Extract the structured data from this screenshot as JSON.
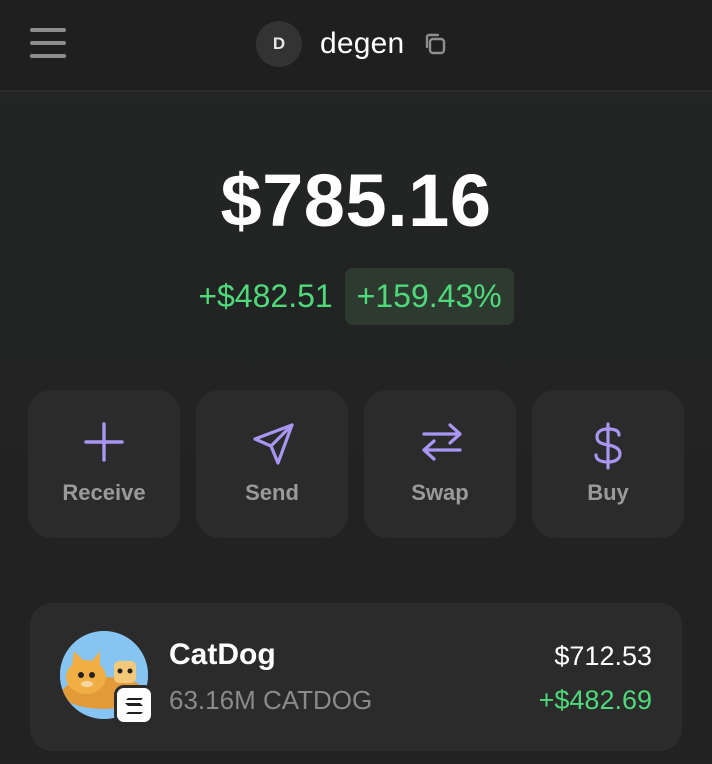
{
  "header": {
    "avatar_initial": "D",
    "account_name": "degen",
    "icons": [
      "menu-icon",
      "copy-icon"
    ]
  },
  "portfolio": {
    "balance": "$785.16",
    "change_abs": "+$482.51",
    "change_pct": "+159.43%"
  },
  "actions": [
    {
      "label": "Receive",
      "icon": "plus-icon"
    },
    {
      "label": "Send",
      "icon": "send-icon"
    },
    {
      "label": "Swap",
      "icon": "swap-icon"
    },
    {
      "label": "Buy",
      "icon": "dollar-icon"
    }
  ],
  "tokens": [
    {
      "name": "CatDog",
      "amount": "63.16M CATDOG",
      "value": "$712.53",
      "change": "+$482.69",
      "chain_icon": "solana-icon"
    }
  ],
  "colors": {
    "accent_purple": "#a996f2",
    "positive_green": "#4ed97a",
    "card_bg": "#2b2b2b",
    "pct_badge_bg": "#2d3a30"
  }
}
